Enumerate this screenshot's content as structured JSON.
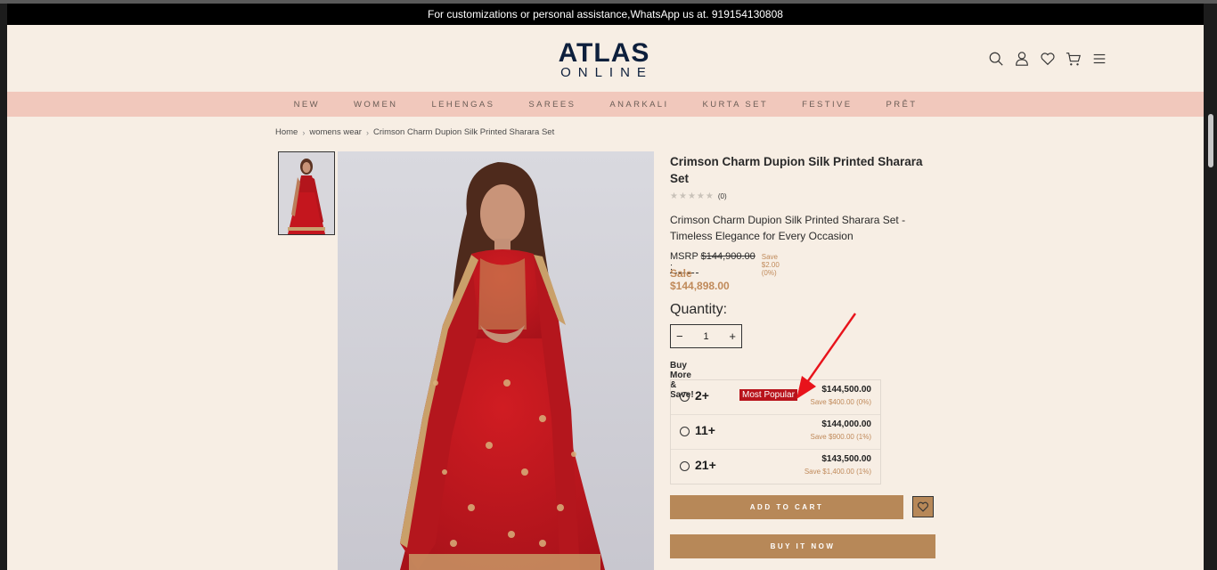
{
  "announcement": "For customizations or personal assistance,WhatsApp us at. 919154130808",
  "brand": {
    "name": "ATLAS",
    "subtitle": "ONLINE",
    "color": "#0d1f3c"
  },
  "header_icons": [
    "search-icon",
    "user-icon",
    "heart-icon",
    "cart-icon",
    "menu-icon"
  ],
  "nav": [
    "NEW",
    "WOMEN",
    "LEHENGAS",
    "SAREES",
    "ANARKALI",
    "KURTA SET",
    "FESTIVE",
    "PRÊT"
  ],
  "breadcrumb": [
    "Home",
    "womens wear",
    "Crimson Charm Dupion Silk Printed Sharara Set"
  ],
  "product": {
    "title": "Crimson Charm Dupion Silk Printed Sharara Set",
    "rating_count": "(0)",
    "rating_stars": 0,
    "description": "Crimson Charm Dupion Silk Printed Sharara Set - Timeless Elegance for Every Occasion",
    "msrp_label": "MSRP :",
    "msrp": "$144,900.00",
    "msrp_save": "Save $2.00 (0%)",
    "sale": "Sale $144,898.00",
    "quantity_label": "Quantity:",
    "quantity": "1",
    "buy_more_label": "Buy More & Save!",
    "tiers": [
      {
        "qty": "2+",
        "badge": "Most Popular",
        "price": "$144,500.00",
        "save": "Save $400.00 (0%)"
      },
      {
        "qty": "11+",
        "badge": "",
        "price": "$144,000.00",
        "save": "Save $900.00 (1%)"
      },
      {
        "qty": "21+",
        "badge": "",
        "price": "$143,500.00",
        "save": "Save $1,400.00 (1%)"
      }
    ],
    "add_to_cart": "ADD TO CART",
    "buy_now": "BUY IT NOW"
  },
  "colors": {
    "accent": "#b78858",
    "nav_bg": "#f1c8bc",
    "page_bg": "#f7eee4",
    "badge": "#b8131b",
    "annotation": "#e8131b"
  }
}
